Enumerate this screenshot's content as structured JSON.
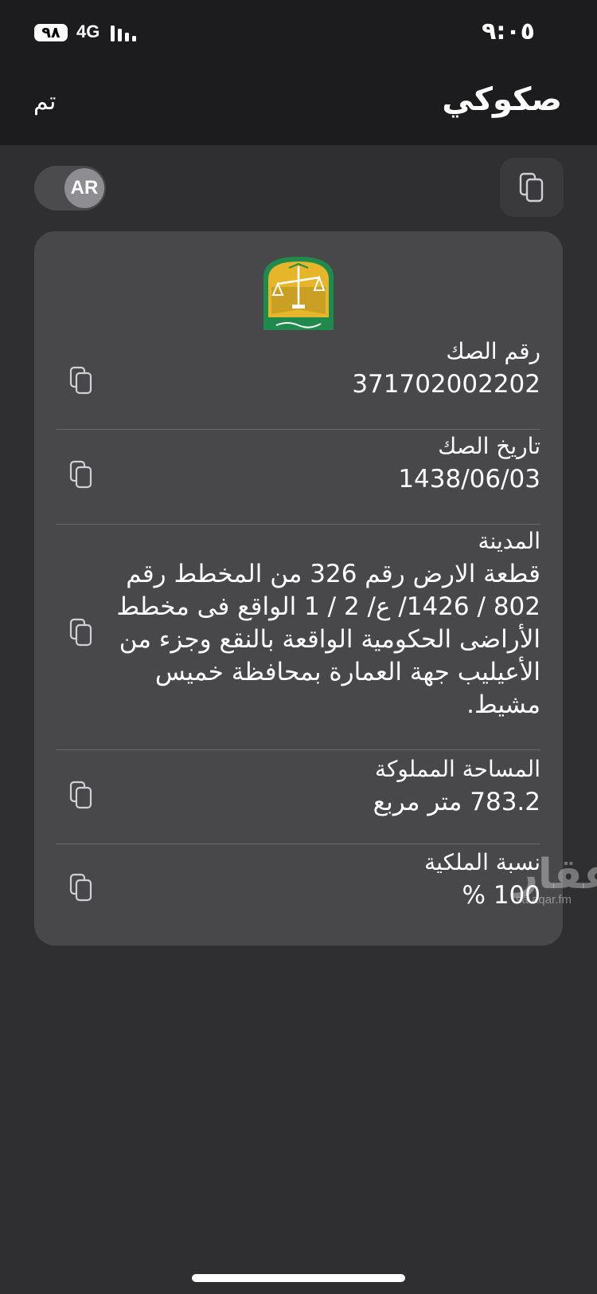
{
  "status_bar": {
    "battery": "٩٨",
    "network": "4G",
    "time": "٩:٠٥"
  },
  "nav": {
    "done_label": "تم",
    "title": "صكوكي"
  },
  "toolbar": {
    "language_toggle": "AR",
    "copy_icon": "copy-icon"
  },
  "deed": {
    "fields": [
      {
        "label": "رقم الصك",
        "value": "371702002202"
      },
      {
        "label": "تاريخ الصك",
        "value": "1438/06/03"
      },
      {
        "label": "المدينة",
        "value": "قطعة الارض رقم 326 من المخطط رقم 802 / 1426/ ع/ 2 / 1 الواقع فى مخطط الأراضى الحكومية الواقعة بالنقع وجزء من الأعيليب جهة العمارة بمحافظة خميس مشيط."
      },
      {
        "label": "المساحة المملوكة",
        "value": "783.2 متر مربع"
      },
      {
        "label": "نسبة الملكية",
        "value": "100 %"
      }
    ]
  },
  "watermark": {
    "logo_text": "عقار",
    "url": "sa.aqar.fm"
  },
  "colors": {
    "background": "#2f2f31",
    "bar": "#1c1c1e",
    "card": "#48484b",
    "emblem_green": "#1f8a4c",
    "emblem_gold": "#e6b52a"
  }
}
